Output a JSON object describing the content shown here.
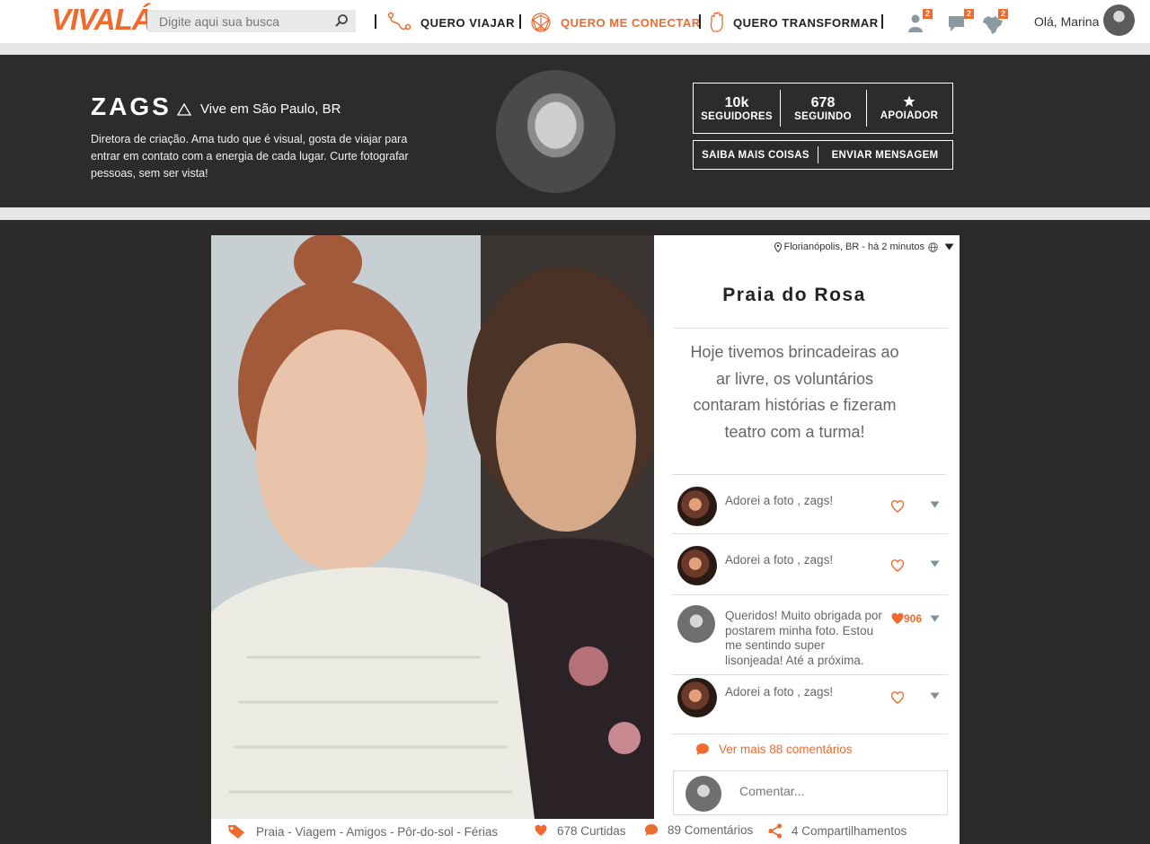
{
  "brand": {
    "logo_text": "VIVALÁ",
    "accent": "#ee6a2e"
  },
  "search": {
    "placeholder": "Digite aqui sua busca"
  },
  "nav": {
    "items": [
      {
        "label": "QUERO VIAJAR",
        "icon": "route-icon"
      },
      {
        "label": "QUERO ME CONECTAR",
        "icon": "network-icon",
        "active": true
      },
      {
        "label": "QUERO TRANSFORMAR",
        "icon": "hand-icon"
      }
    ]
  },
  "notifications": {
    "users": "2",
    "messages": "2",
    "map": "2"
  },
  "user": {
    "greeting": "Olá, Marina"
  },
  "profile": {
    "name": "ZAGS",
    "location": "Vive em São Paulo, BR",
    "bio": "Diretora de criação. Ama tudo que é visual, gosta de viajar para entrar em contato com a energia de cada lugar. Curte fotografar pessoas, sem ser vista!",
    "stats": {
      "followers": {
        "value": "10k",
        "label": "SEGUIDORES"
      },
      "following": {
        "value": "678",
        "label": "SEGUINDO"
      },
      "supporter": {
        "label": "APOIADOR"
      }
    },
    "actions": {
      "more": "SAIBA MAIS COISAS",
      "message": "ENVIAR MENSAGEM"
    }
  },
  "post": {
    "meta": "Florianópolis, BR - há 2 minutos",
    "title": "Praia do Rosa",
    "description": "Hoje tivemos brincadeiras ao ar livre, os voluntários contaram histórias e fizeram teatro com a turma!",
    "comments": [
      {
        "text": "Adorei a foto , zags!",
        "liked": false,
        "count": ""
      },
      {
        "text": "Adorei a foto , zags!",
        "liked": false,
        "count": ""
      },
      {
        "text": "Queridos! Muito obrigada por postarem minha foto. Estou me sentindo super lisonjeada! Até a próxima.",
        "liked": true,
        "count": "906"
      },
      {
        "text": "Adorei a foto , zags!",
        "liked": false,
        "count": ""
      }
    ],
    "more_comments": "Ver mais 88 comentários",
    "comment_placeholder": "Comentar...",
    "tags": "Praia - Viagem - Amigos - Pôr-do-sol - Férias",
    "likes": "678 Curtidas",
    "comment_count": "89 Comentários",
    "shares": "4 Compartilhamentos"
  }
}
